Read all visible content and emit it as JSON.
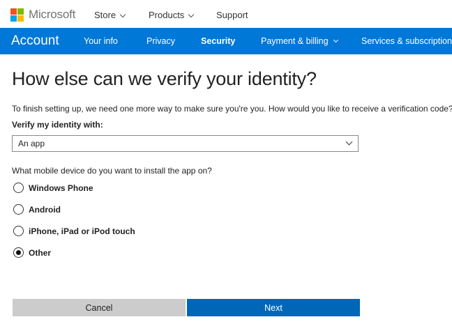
{
  "header": {
    "logo_text": "Microsoft",
    "logo_colors": [
      "#f25022",
      "#7fba00",
      "#00a4ef",
      "#ffb900"
    ],
    "nav": [
      {
        "label": "Store",
        "has_dropdown": true
      },
      {
        "label": "Products",
        "has_dropdown": true
      },
      {
        "label": "Support",
        "has_dropdown": false
      }
    ]
  },
  "account_nav": {
    "brand": "Account",
    "accent_color": "#0078d7",
    "items": [
      {
        "label": "Your info",
        "active": false
      },
      {
        "label": "Privacy",
        "active": false
      },
      {
        "label": "Security",
        "active": true
      },
      {
        "label": "Payment & billing",
        "active": false,
        "has_dropdown": true
      },
      {
        "label": "Services & subscriptions",
        "active": false
      }
    ]
  },
  "main": {
    "title": "How else can we verify your identity?",
    "description": "To finish setting up, we need one more way to make sure you're you. How would you like to receive a verification code?",
    "verify_label": "Verify my identity with:",
    "verify_select_value": "An app",
    "device_question": "What mobile device do you want to install the app on?",
    "devices": [
      {
        "label": "Windows Phone",
        "checked": false
      },
      {
        "label": "Android",
        "checked": false
      },
      {
        "label": "iPhone, iPad or iPod touch",
        "checked": false
      },
      {
        "label": "Other",
        "checked": true
      }
    ]
  },
  "actions": {
    "cancel_label": "Cancel",
    "next_label": "Next"
  }
}
